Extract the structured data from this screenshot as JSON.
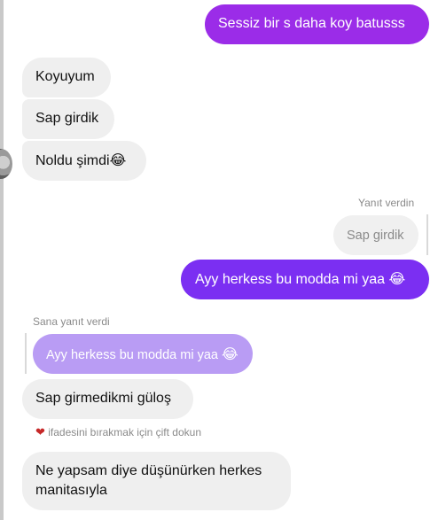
{
  "messages": {
    "m1": "Sessiz bir s daha koy batusss",
    "m2": "Koyuyum",
    "m3": "Sap girdik",
    "m4": "Noldu şimdi",
    "reply_meta_you": "Yanıt verdin",
    "m5_quote": "Sap girdik",
    "m5": "Ayy herkess bu modda mi yaa",
    "reply_meta_them": "Sana yanıt verdi",
    "m6_quote": "Ayy herkess bu modda mi yaa",
    "m6": "Sap girmedikmi güloş",
    "reaction_hint": "ifadesini bırakmak için çift dokun",
    "m7_line1": "Ne yapsam diye düşünürken herkes",
    "m7_line2": "manitasıyla"
  },
  "emojis": {
    "laugh": "😂",
    "heart": "❤"
  },
  "colors": {
    "outgoing": "#7b2ff2",
    "incoming": "#efefef",
    "quoted_outgoing": "#b99cf4",
    "heart": "#c62828"
  }
}
